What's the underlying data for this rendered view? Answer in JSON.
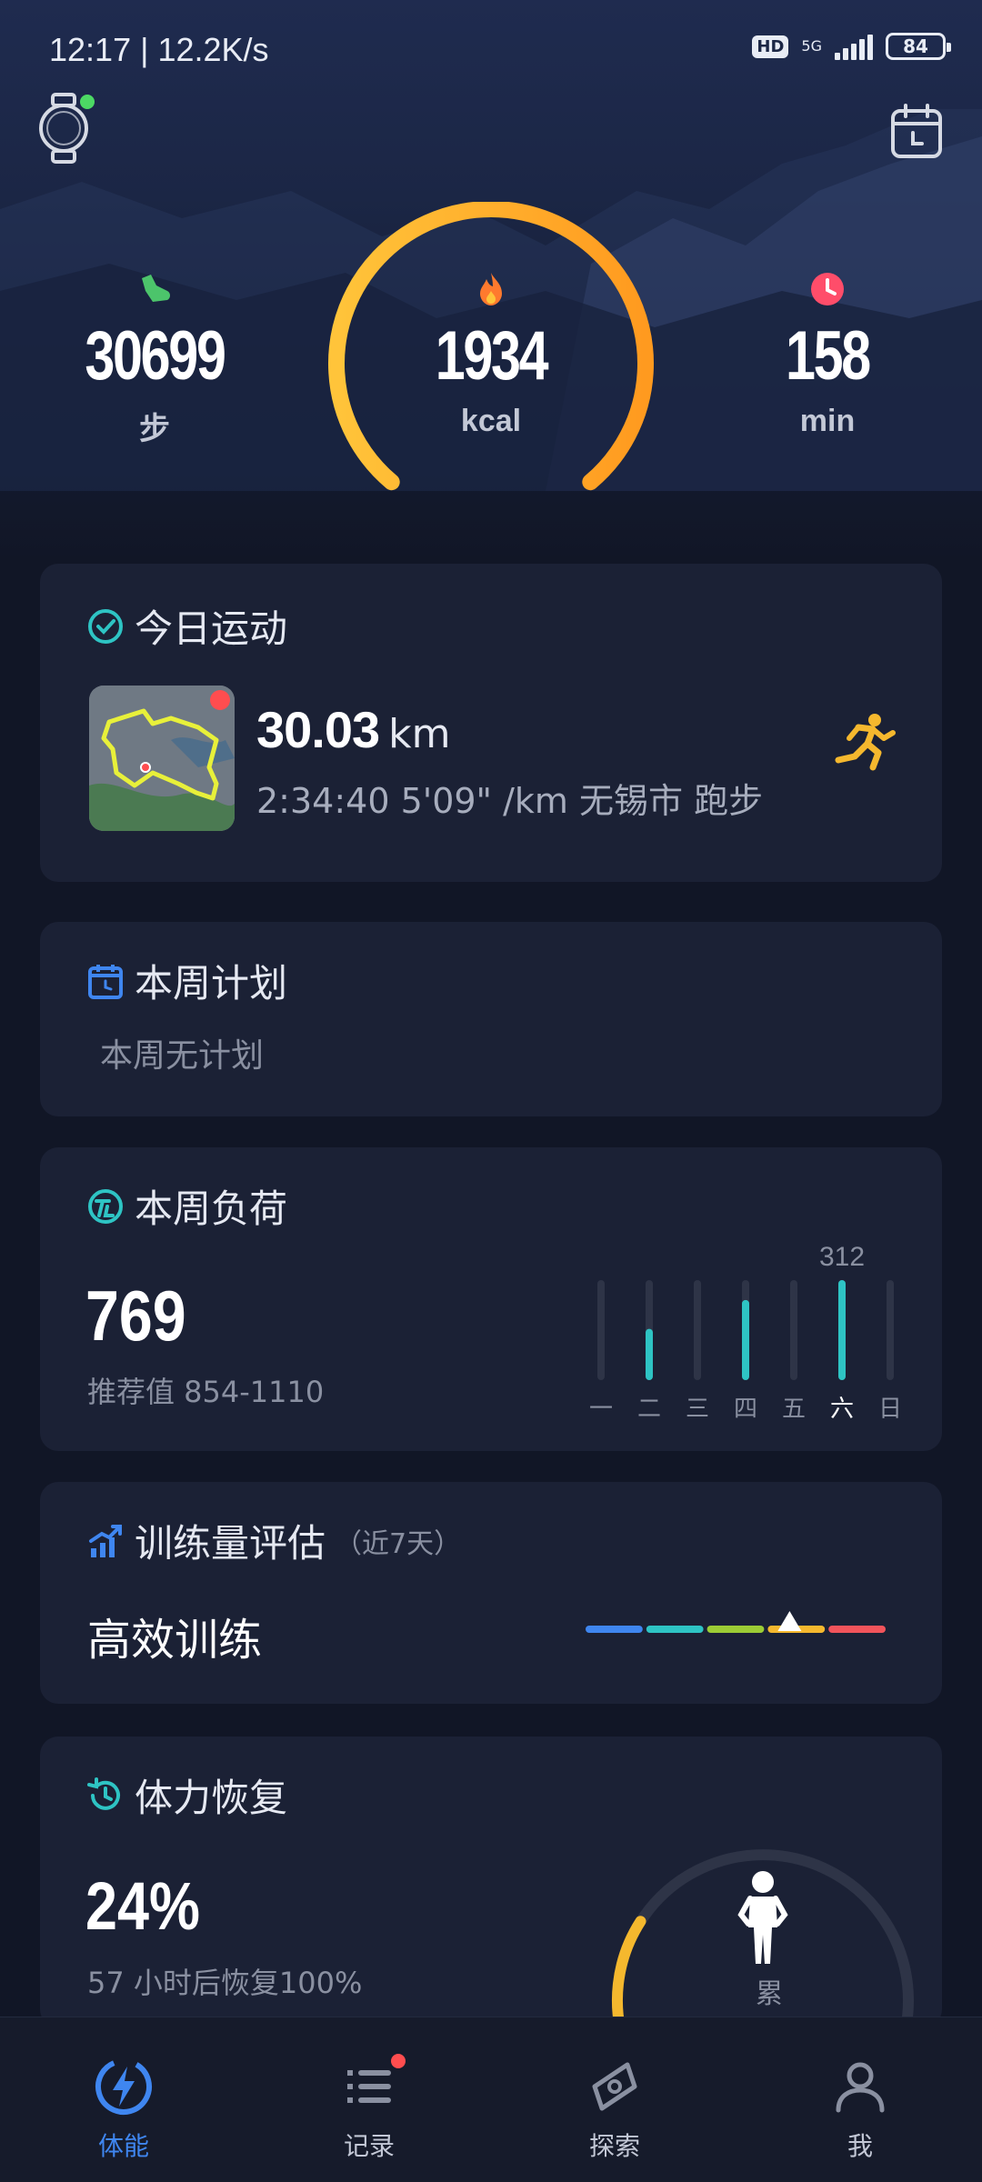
{
  "status_bar": {
    "time": "12:17 | 12.2K/s",
    "hd": "HD",
    "network": "5G",
    "battery": "84"
  },
  "summary": {
    "steps": {
      "value": "30699",
      "unit": "步",
      "icon": "shoe-icon"
    },
    "calories": {
      "value": "1934",
      "unit": "kcal",
      "icon": "flame-icon",
      "ring_progress": 0.75
    },
    "minutes": {
      "value": "158",
      "unit": "min",
      "icon": "clock-icon"
    },
    "colors": {
      "steps": "#4cc46b",
      "calories": "#f5a623",
      "minutes": "#ff4d6a"
    }
  },
  "today": {
    "title": "今日运动",
    "distance": "30.03",
    "distance_unit": "km",
    "detail": "2:34:40  5'09\" /km  无锡市 跑步"
  },
  "plan": {
    "title": "本周计划",
    "empty_text": "本周无计划"
  },
  "load": {
    "title": "本周负荷",
    "value": "769",
    "range": "推荐值 854-1110",
    "chart_data": {
      "type": "bar",
      "categories": [
        "一",
        "二",
        "三",
        "四",
        "五",
        "六",
        "日"
      ],
      "values": [
        0,
        160,
        0,
        250,
        0,
        312,
        0
      ],
      "peak_label": "312",
      "highlight": "六"
    }
  },
  "evaluation": {
    "title": "训练量评估",
    "subtitle": "（近7天）",
    "result": "高效训练",
    "segment_colors": [
      "#3f86f0",
      "#2ec4c4",
      "#9ccc35",
      "#f5b82e",
      "#f2545b"
    ],
    "marker_position": 0.68
  },
  "recovery": {
    "title": "体力恢复",
    "value": "24%",
    "text": "57 小时后恢复100%",
    "status": "累",
    "level": 0.24
  },
  "nav": [
    {
      "label": "体能",
      "icon": "bolt-icon",
      "active": true
    },
    {
      "label": "记录",
      "icon": "list-icon",
      "active": false,
      "badge": true
    },
    {
      "label": "探索",
      "icon": "compass-icon",
      "active": false
    },
    {
      "label": "我",
      "icon": "person-icon",
      "active": false
    }
  ]
}
